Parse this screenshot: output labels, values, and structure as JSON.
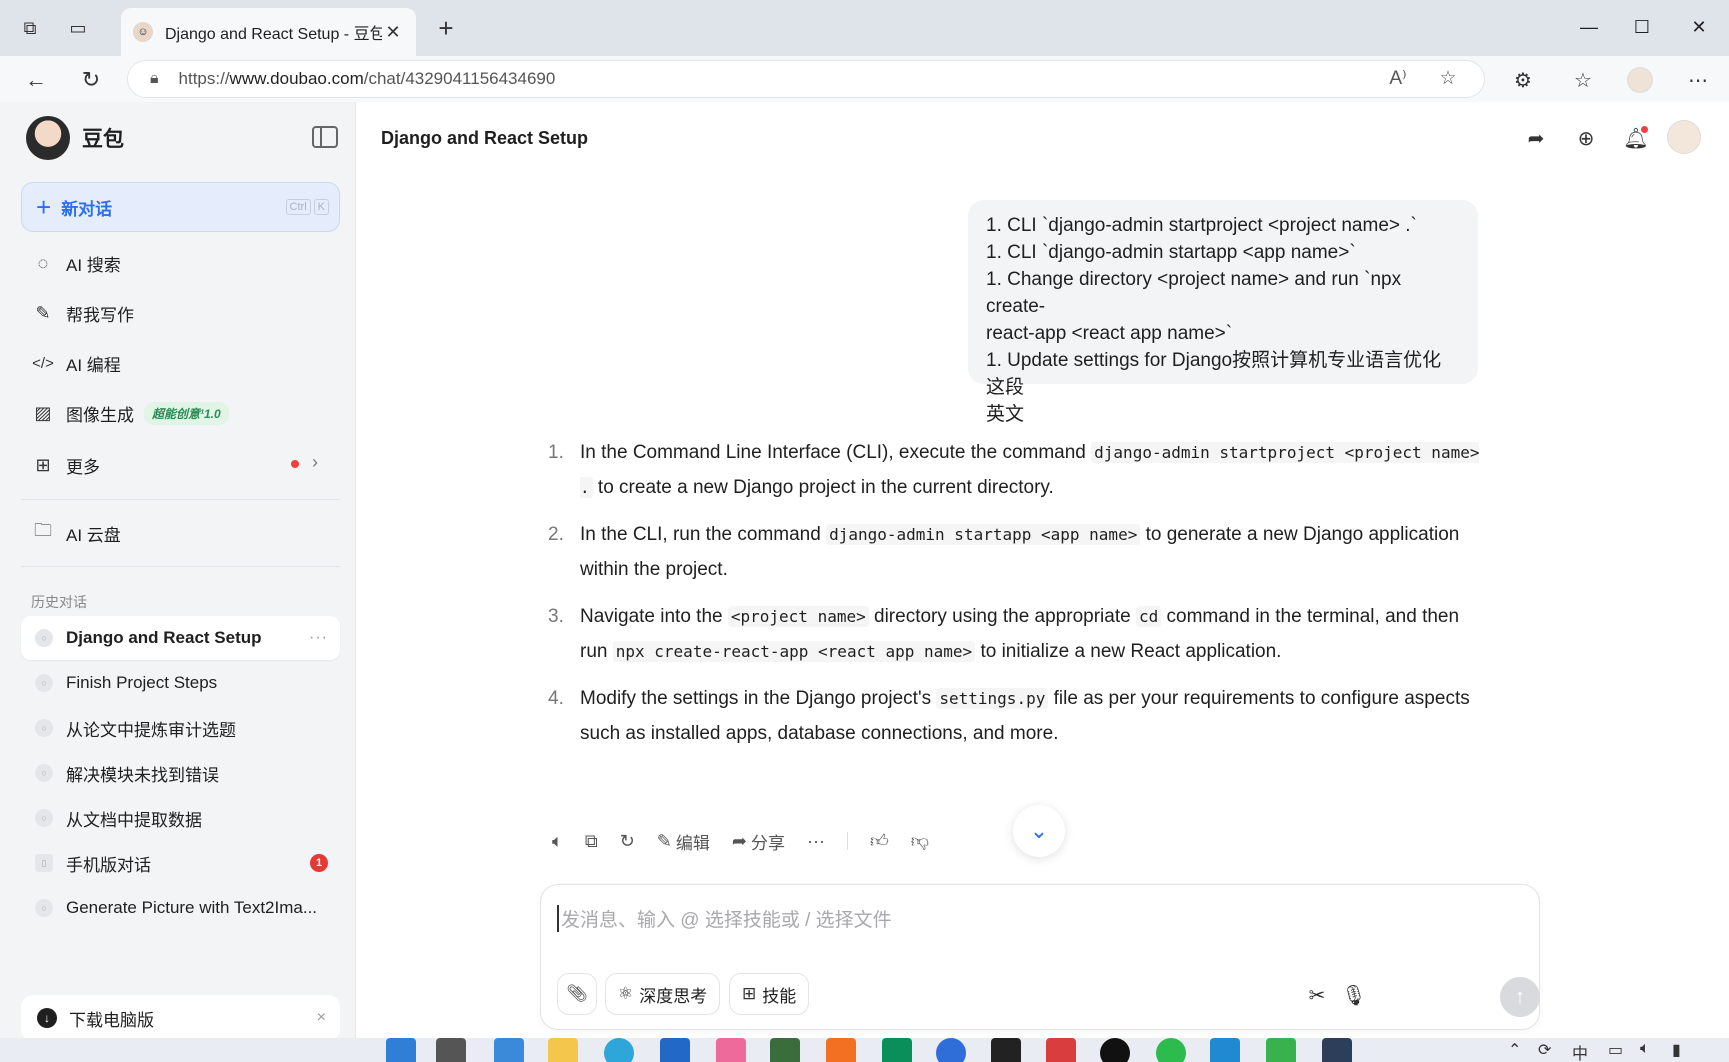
{
  "browser": {
    "tab_title": "Django and React Setup - 豆包",
    "tab_close": "✕",
    "new_tab": "+",
    "url_prefix": "https://",
    "url_host": "www.doubao.com",
    "url_path": "/chat/4329041156434690",
    "read_aloud_icon": "A⁾",
    "favorite_icon": "☆"
  },
  "sidebar": {
    "brand": "豆包",
    "new_chat": {
      "label": "新对话",
      "kbd1": "Ctrl",
      "kbd2": "K"
    },
    "menu": [
      {
        "label": "AI 搜索",
        "icon": "search-spark-icon"
      },
      {
        "label": "帮我写作",
        "icon": "pen-icon"
      },
      {
        "label": "AI 编程",
        "icon": "code-icon"
      },
      {
        "label": "图像生成",
        "icon": "image-icon",
        "badge": "超能创意¹1.0"
      },
      {
        "label": "更多",
        "icon": "grid-icon"
      }
    ],
    "cloud": {
      "label": "AI 云盘"
    },
    "history_title": "历史对话",
    "history": [
      {
        "label": "Django and React Setup",
        "more": "···"
      },
      {
        "label": "Finish Project Steps"
      },
      {
        "label": "从论文中提炼审计选题"
      },
      {
        "label": "解决模块未找到错误"
      },
      {
        "label": "从文档中提取数据"
      },
      {
        "label": "手机版对话",
        "count": "1"
      },
      {
        "label": "Generate Picture with Text2Ima..."
      }
    ],
    "download": {
      "label": "下载电脑版",
      "close": "×"
    }
  },
  "main": {
    "title": "Django and React Setup",
    "user_message": [
      "1. CLI `django-admin startproject <project name> .`",
      "1. CLI `django-admin startapp <app name>`",
      "1. Change directory <project name> and run `npx create-",
      "react-app <react app name>`",
      "1. Update settings for Django按照计算机专业语言优化这段",
      "英文"
    ],
    "answer": [
      {
        "num": "1.",
        "pre": "In the Command Line Interface (CLI), execute the command ",
        "code": "django-admin startproject <project name> .",
        "post": " to create a new Django project in the current directory."
      },
      {
        "num": "2.",
        "pre": "In the CLI, run the command ",
        "code": "django-admin startapp <app name>",
        "post": " to generate a new Django application within the project."
      },
      {
        "num": "3.",
        "pre": "Navigate into the ",
        "code": "<project name>",
        "mid": " directory using the appropriate ",
        "code2": "cd",
        "mid2": " command in the terminal, and then run ",
        "code3": "npx create-react-app <react app name>",
        "post": " to initialize a new React application."
      },
      {
        "num": "4.",
        "pre": "Modify the settings in the Django project's ",
        "code": "settings.py",
        "post": " file as per your requirements to configure aspects such as installed apps, database connections, and more."
      }
    ],
    "actions": {
      "edit": "编辑",
      "share": "分享",
      "more": "···"
    },
    "composer": {
      "placeholder": "发消息、输入 @ 选择技能或 / 选择文件",
      "deep_think": "深度思考",
      "skills": "技能"
    }
  },
  "taskbar": {
    "ime": "中"
  },
  "colors": {
    "accent": "#2c6ff0",
    "sidebar_bg": "#f3f4f6",
    "notification_red": "#f04040"
  }
}
